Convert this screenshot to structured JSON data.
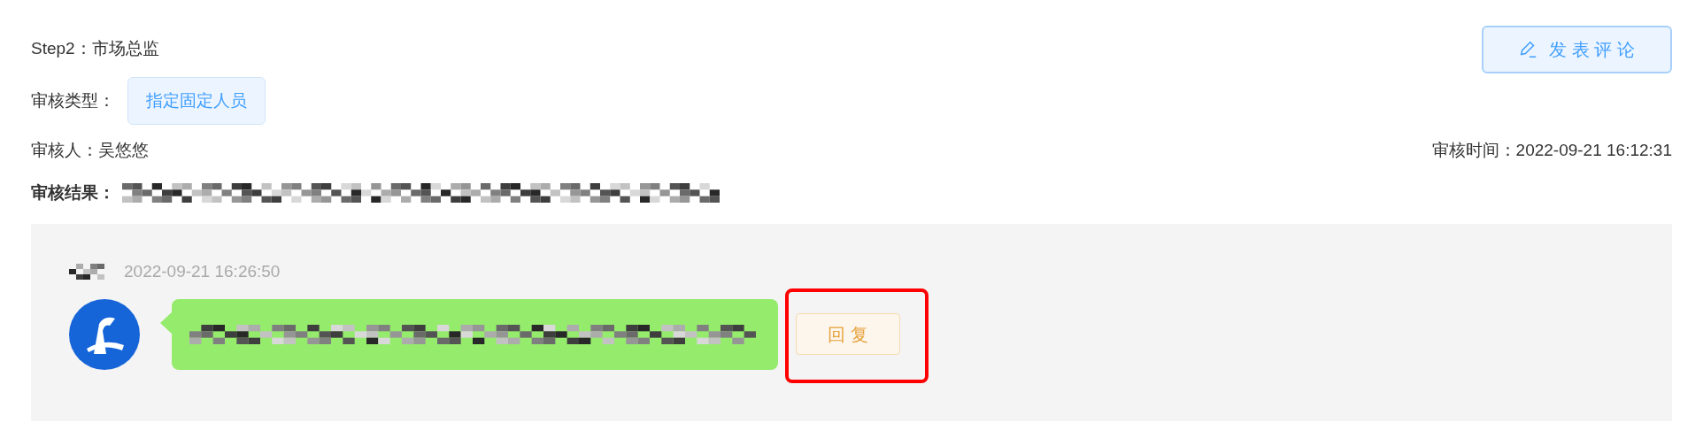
{
  "step": {
    "title": "Step2：市场总监"
  },
  "publish_button": {
    "label": "发 表 评 论"
  },
  "review_type": {
    "label": "审核类型：",
    "tag": "指定固定人员"
  },
  "reviewer": {
    "label": "审核人：",
    "value": "吴悠悠"
  },
  "review_time": {
    "label": "审核时间：",
    "value": "2022-09-21 16:12:31"
  },
  "review_result": {
    "label": "审核结果："
  },
  "comments": [
    {
      "time": "2022-09-21 16:26:50",
      "reply_button": {
        "label": "回 复",
        "highlighted": true
      }
    }
  ]
}
